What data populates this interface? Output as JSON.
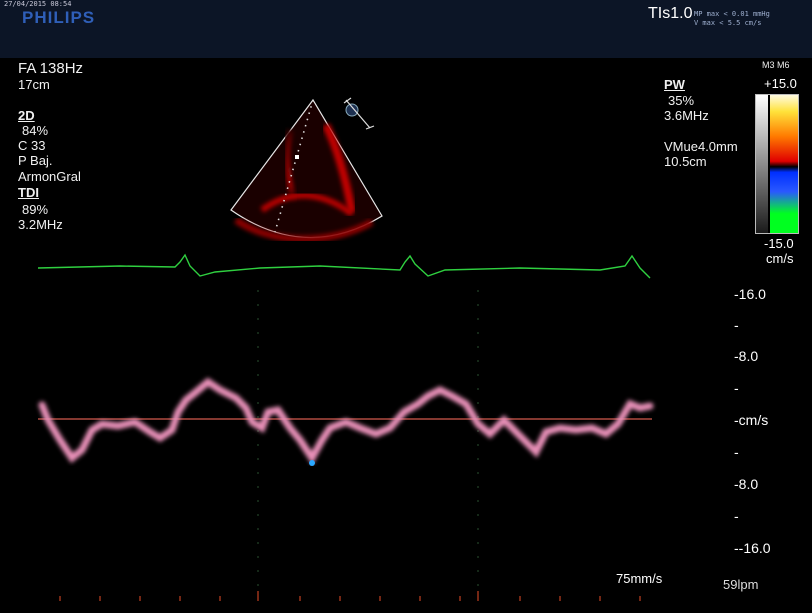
{
  "header": {
    "datetime": "27/04/2015 08:54",
    "brand": "PHILIPS",
    "probe_index": "TIs1.0",
    "mi_sub": [
      "MP max < 0.01 mmHg",
      "V max < 5.5 cm/s"
    ]
  },
  "left_panel": {
    "mode": "FA 138Hz",
    "depth": "17cm",
    "section_2d": {
      "label": "2D",
      "gain": "84%",
      "compress": "C 33",
      "power": "P Baj.",
      "harmonic": "ArmonGral"
    },
    "section_tdi": {
      "label": "TDI",
      "gain": "89%",
      "freq": "3.2MHz"
    }
  },
  "right_panel": {
    "pw": {
      "label": "PW",
      "gain": "35%",
      "freq": "3.6MHz"
    },
    "sample_volume": "VMue4.0mm",
    "sample_depth": "10.5cm"
  },
  "colorbar": {
    "title": "M3 M6",
    "max": "+15.0",
    "min": "-15.0",
    "unit": "cm/s"
  },
  "velocity_scale": [
    "-16.0",
    "-",
    "-8.0",
    "-",
    "-cm/s",
    "-",
    "-8.0",
    "-",
    "--16.0"
  ],
  "footer": {
    "sweep": "75mm/s",
    "heart_rate": "59lpm"
  },
  "icons": {
    "probe_marker": "probe-orientation-icon"
  }
}
